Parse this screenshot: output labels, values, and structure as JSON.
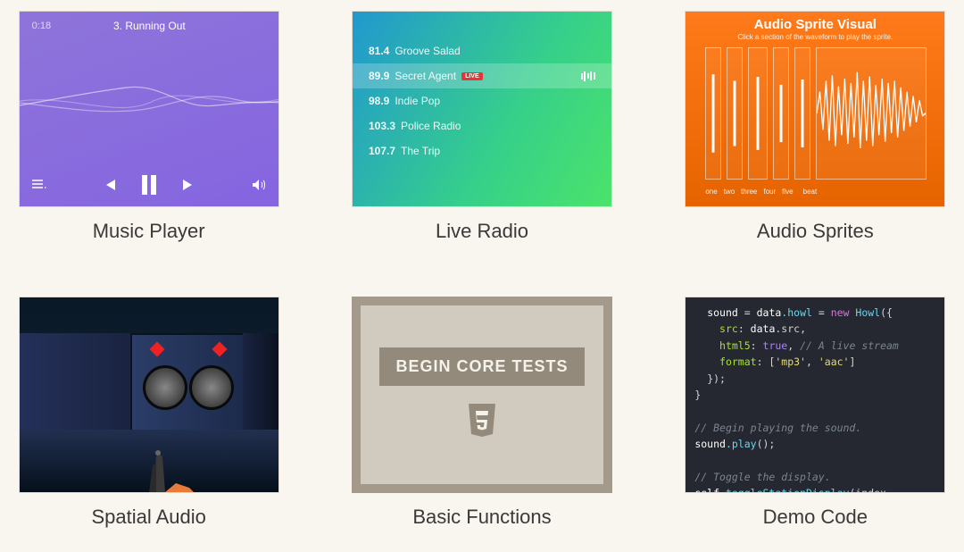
{
  "cards": {
    "music": {
      "label": "Music Player",
      "time": "0:18",
      "title": "3. Running Out"
    },
    "radio": {
      "label": "Live Radio",
      "stations": [
        {
          "freq": "81.4",
          "name": "Groove Salad",
          "active": false,
          "live": false
        },
        {
          "freq": "89.9",
          "name": "Secret Agent",
          "active": true,
          "live": true
        },
        {
          "freq": "98.9",
          "name": "Indie Pop",
          "active": false,
          "live": false
        },
        {
          "freq": "103.3",
          "name": "Police Radio",
          "active": false,
          "live": false
        },
        {
          "freq": "107.7",
          "name": "The Trip",
          "active": false,
          "live": false
        }
      ],
      "live_badge": "LIVE"
    },
    "sprites": {
      "label": "Audio Sprites",
      "title": "Audio Sprite Visual",
      "subtitle": "Click a section of the waveform to play the sprite.",
      "tracks": [
        "one",
        "two",
        "three",
        "four",
        "five",
        "beat"
      ]
    },
    "spatial": {
      "label": "Spatial Audio"
    },
    "functions": {
      "label": "Basic Functions",
      "button": "BEGIN CORE TESTS"
    },
    "code": {
      "label": "Demo Code",
      "lines": {
        "l1a": "sound",
        "l1b": " = ",
        "l1c": "data",
        "l1d": ".howl",
        "l1e": " = ",
        "l1f": "new",
        "l1g": " Howl",
        "l1h": "({",
        "l2a": "src",
        "l2b": ": ",
        "l2c": "data",
        "l2d": ".src,",
        "l3a": "html5",
        "l3b": ": ",
        "l3c": "true",
        "l3d": ", ",
        "l3e": "// A live stream",
        "l4a": "format",
        "l4b": ": [",
        "l4c": "'mp3'",
        "l4d": ", ",
        "l4e": "'aac'",
        "l4f": "]",
        "l5": "});",
        "l6": "}",
        "l7": "// Begin playing the sound.",
        "l8a": "sound",
        "l8b": ".play",
        "l8c": "();",
        "l9": "// Toggle the display.",
        "l10a": "self",
        "l10b": ".toggleStationDisplay",
        "l10c": "(index,"
      }
    }
  }
}
